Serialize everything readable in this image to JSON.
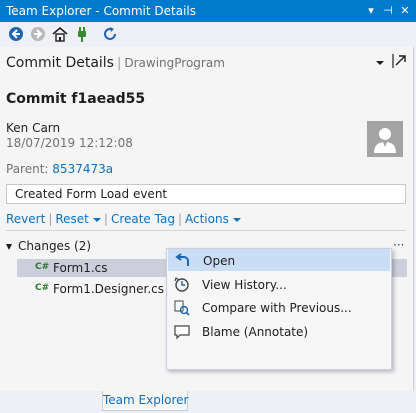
{
  "window": {
    "title": "Team Explorer - Commit Details",
    "title_buttons": [
      "▾",
      "⊣",
      "✕"
    ]
  },
  "toolbar": {
    "icons": [
      "back-icon",
      "forward-icon",
      "home-icon",
      "connect-icon",
      "refresh-icon"
    ]
  },
  "header": {
    "title": "Commit Details",
    "separator": "|",
    "repo": "DrawingProgram"
  },
  "commit": {
    "title": "Commit f1aead55",
    "author": "Ken Carn",
    "date": "18/07/2019 12:12:08",
    "parent_label": "Parent:",
    "parent_hash": "8537473a",
    "message": "Created Form Load event"
  },
  "actions": {
    "revert": "Revert",
    "reset": "Reset",
    "create_tag": "Create Tag",
    "actions": "Actions",
    "separator": "|"
  },
  "changes": {
    "label": "Changes (2)",
    "more": "···",
    "files": [
      {
        "icon": "C#",
        "name": "Form1.cs",
        "selected": true
      },
      {
        "icon": "C#",
        "name": "Form1.Designer.cs",
        "selected": false
      }
    ]
  },
  "context_menu": {
    "items": [
      {
        "label": "Open",
        "icon": "open-icon",
        "highlighted": true
      },
      {
        "label": "View History...",
        "icon": "history-icon",
        "highlighted": false
      },
      {
        "label": "Compare with Previous...",
        "icon": "compare-icon",
        "highlighted": false
      },
      {
        "label": "Blame (Annotate)",
        "icon": "blame-icon",
        "highlighted": false
      }
    ]
  },
  "bottom_tab": {
    "label": "Team Explorer"
  },
  "colors": {
    "accent": "#007acc",
    "link": "#0e70c0",
    "selection": "#cccedb",
    "menu_highlight": "#c9def5"
  }
}
